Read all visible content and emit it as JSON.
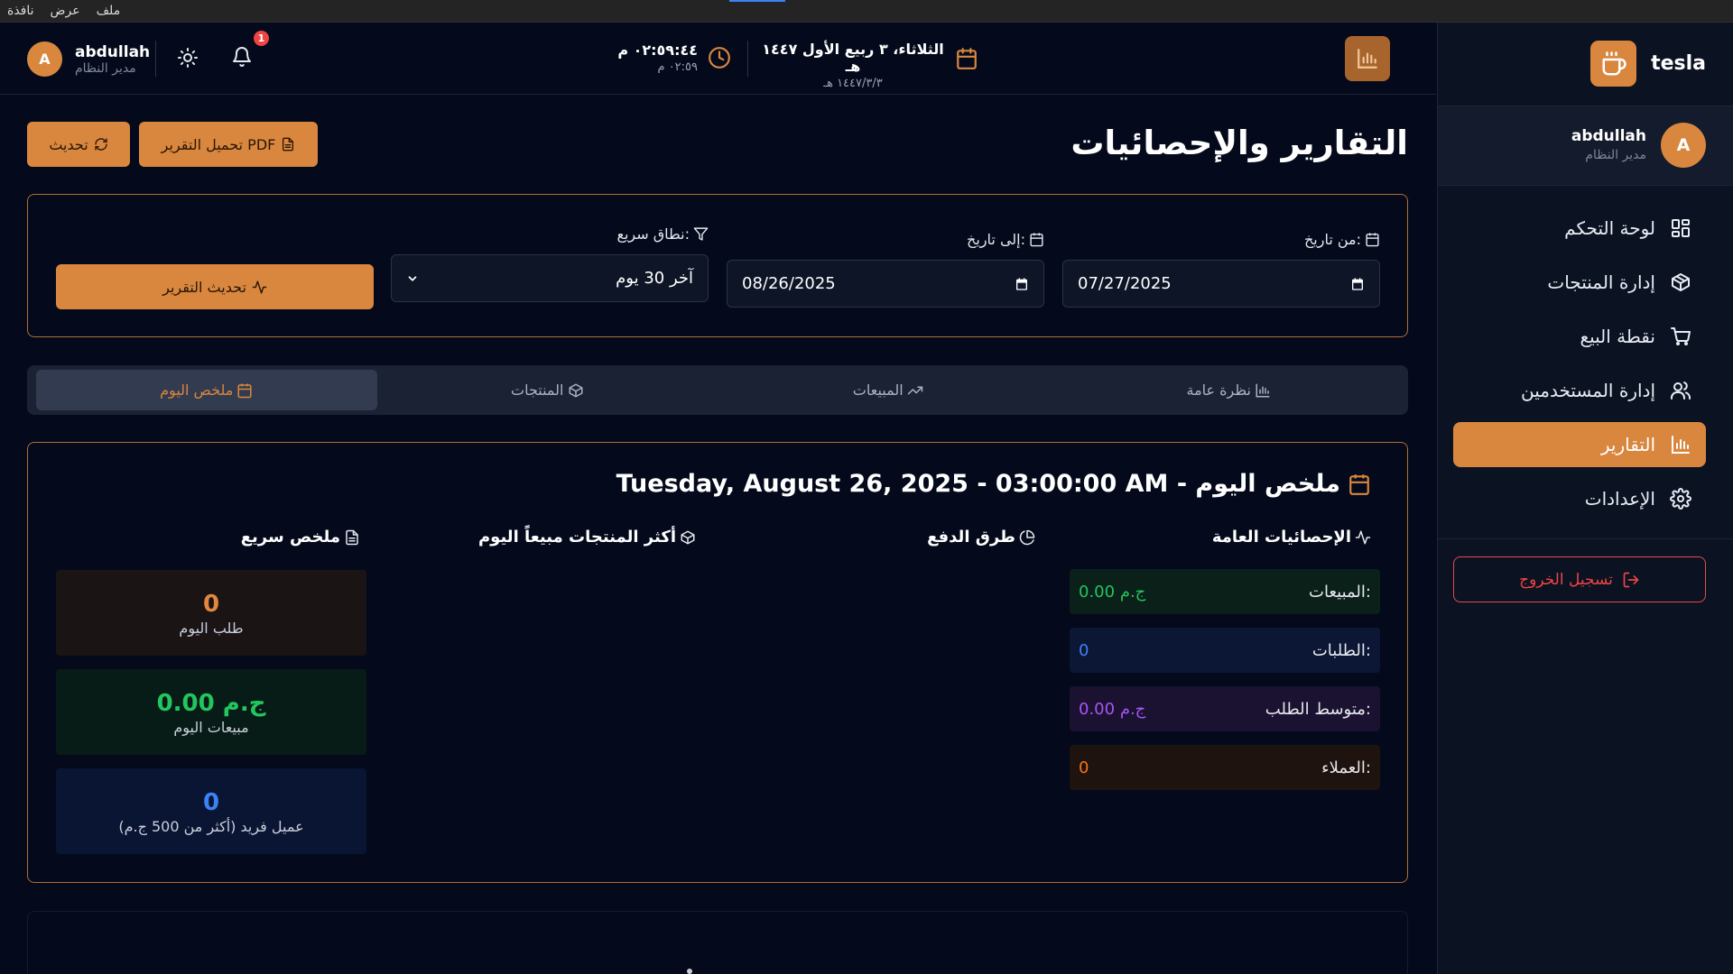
{
  "menubar": {
    "items": [
      "ملف",
      "عرض",
      "نافذة"
    ]
  },
  "sidebar": {
    "brand": "tesla",
    "user": {
      "initial": "A",
      "name": "abdullah",
      "role": "مدير النظام"
    },
    "items": [
      {
        "label": "لوحة التحكم",
        "icon": "grid-icon"
      },
      {
        "label": "إدارة المنتجات",
        "icon": "box-icon"
      },
      {
        "label": "نقطة البيع",
        "icon": "cart-icon"
      },
      {
        "label": "إدارة المستخدمين",
        "icon": "users-icon"
      },
      {
        "label": "التقارير",
        "icon": "bar-chart-icon",
        "active": true
      },
      {
        "label": "الإعدادات",
        "icon": "gear-icon"
      }
    ],
    "logout": "تسجيل الخروج"
  },
  "header": {
    "user": {
      "initial": "A",
      "name": "abdullah",
      "role": "مدير النظام"
    },
    "notifications": "1",
    "time_main": "٠٢:٥٩:٤٤ م",
    "time_sub": "٠٢:٥٩ م",
    "date_main": "الثلاثاء، ٣ ربيع الأول ١٤٤٧ هـ",
    "date_sub": "١٤٤٧/٣/٣ هـ"
  },
  "page": {
    "title": "التقارير والإحصائيات",
    "pdf_button": "تحميل التقرير PDF",
    "refresh_button": "تحديث"
  },
  "filters": {
    "from_label": "من تاريخ:",
    "from_value": "07/27/2025",
    "to_label": "إلى تاريخ:",
    "to_value": "08/26/2025",
    "range_label": "نطاق سريع:",
    "range_value": "آخر 30 يوم",
    "update_button": "تحديث التقرير"
  },
  "tabs": [
    {
      "label": "نظرة عامة",
      "icon": "bar-chart-icon"
    },
    {
      "label": "المبيعات",
      "icon": "trend-icon"
    },
    {
      "label": "المنتجات",
      "icon": "box-icon"
    },
    {
      "label": "ملخص اليوم",
      "icon": "calendar-icon",
      "active": true
    }
  ],
  "summary": {
    "title": "ملخص اليوم - Tuesday, August 26, 2025 - 03:00:00 AM",
    "general_title": "الإحصائيات العامة",
    "payments_title": "طرق الدفع",
    "top_products_title": "أكثر المنتجات مبيعاً اليوم",
    "quick_title": "ملخص سريع",
    "stats": [
      {
        "label": "المبيعات:",
        "value": "0.00 ج.م",
        "color": "#22c55e",
        "bg": "#0b2018"
      },
      {
        "label": "الطلبات:",
        "value": "0",
        "color": "#3b82f6",
        "bg": "#0b1734"
      },
      {
        "label": "متوسط الطلب:",
        "value": "0.00 ج.م",
        "color": "#a855f7",
        "bg": "#1a1230"
      },
      {
        "label": "العملاء:",
        "value": "0",
        "color": "#f97316",
        "bg": "#1e130f"
      }
    ],
    "quick": [
      {
        "value": "0",
        "caption": "طلب اليوم",
        "color": "#e2873f",
        "bg": "#1a1415"
      },
      {
        "value": "0.00 ج.م",
        "caption": "مبيعات اليوم",
        "color": "#22c55e",
        "bg": "#071b17"
      },
      {
        "value": "0",
        "caption": "عميل فريد (أكثر من 500 ج.م)",
        "color": "#3b82f6",
        "bg": "#0a1533"
      }
    ]
  },
  "colors": {
    "accent": "#d9873f",
    "background": "#040a1b",
    "sidebar": "#0b1222",
    "danger": "#ef4444"
  }
}
